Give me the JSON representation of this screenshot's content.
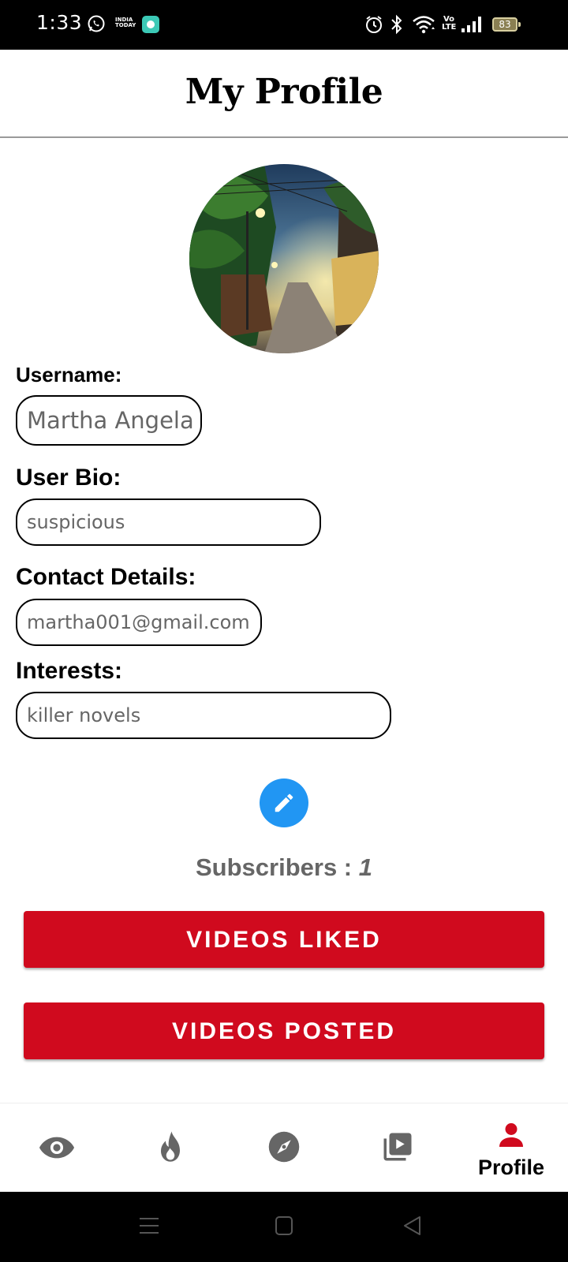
{
  "status_bar": {
    "time": "1:33",
    "news_badge": "INDIA TODAY",
    "volte": "Vo LTE",
    "battery": "83"
  },
  "header": {
    "title": "My Profile"
  },
  "profile": {
    "avatar": "rainy-street-photo",
    "fields": {
      "username": {
        "label": "Username:",
        "value": "Martha Angela"
      },
      "bio": {
        "label": "User Bio:",
        "value": "suspicious"
      },
      "contact": {
        "label": "Contact Details:",
        "value": "martha001@gmail.com"
      },
      "interests": {
        "label": "Interests:",
        "value": "killer novels"
      }
    },
    "edit_icon": "pencil-icon",
    "subscribers": {
      "label": "Subscribers : ",
      "count": "1"
    }
  },
  "buttons": {
    "videos_liked": "VIDEOS LIKED",
    "videos_posted": "VIDEOS POSTED"
  },
  "bottom_nav": {
    "items": [
      {
        "icon": "eye-icon",
        "label": ""
      },
      {
        "icon": "fire-icon",
        "label": ""
      },
      {
        "icon": "compass-icon",
        "label": ""
      },
      {
        "icon": "video-library-icon",
        "label": ""
      },
      {
        "icon": "person-icon",
        "label": "Profile",
        "active": true
      }
    ]
  },
  "colors": {
    "accent_red": "#d00a1e",
    "edit_blue": "#2196f3",
    "nav_gray": "#666666"
  }
}
